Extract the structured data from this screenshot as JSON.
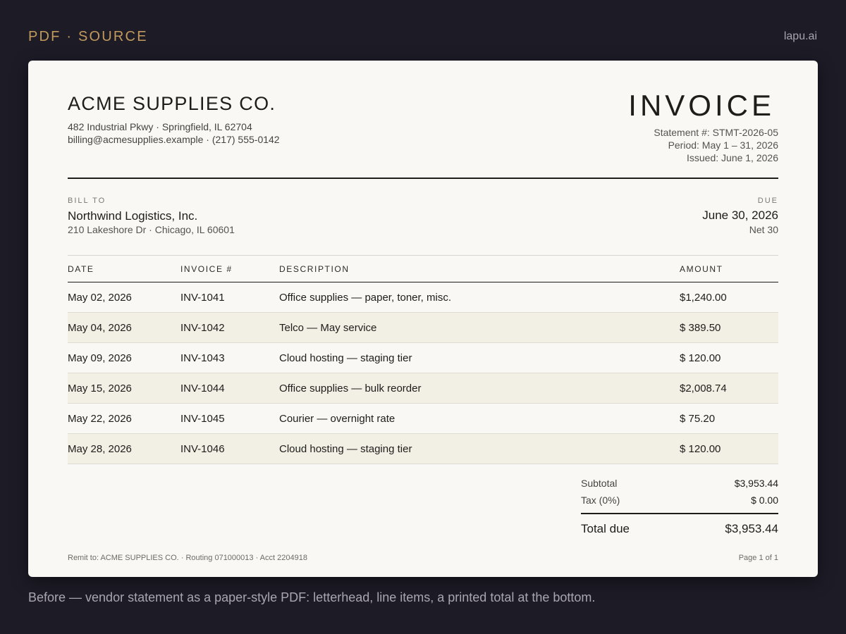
{
  "header": {
    "label": "PDF · SOURCE",
    "brand": "lapu.ai"
  },
  "invoice": {
    "company": "ACME SUPPLIES CO.",
    "address_line": "482 Industrial Pkwy · Springfield, IL 62704",
    "contact_line": "billing@acmesupplies.example  · (217) 555-0142",
    "title": "INVOICE",
    "statement": "Statement #: STMT-2026-05",
    "period": "Period: May 1 – 31, 2026",
    "issued": "Issued: June 1, 2026",
    "bill_to_label": "BILL TO",
    "bill_to_name": "Northwind Logistics, Inc.",
    "bill_to_address": "210 Lakeshore Dr · Chicago, IL 60601",
    "due_label": "DUE",
    "due_date": "June 30, 2026",
    "due_terms": "Net 30",
    "columns": {
      "date": "DATE",
      "invoice": "INVOICE #",
      "description": "DESCRIPTION",
      "amount": "AMOUNT"
    },
    "rows": [
      {
        "date": "May 02, 2026",
        "invoice": "INV-1041",
        "description": "Office supplies — paper, toner, misc.",
        "amount": "$1,240.00"
      },
      {
        "date": "May 04, 2026",
        "invoice": "INV-1042",
        "description": "Telco — May service",
        "amount": "$ 389.50"
      },
      {
        "date": "May 09, 2026",
        "invoice": "INV-1043",
        "description": "Cloud hosting — staging tier",
        "amount": "$ 120.00"
      },
      {
        "date": "May 15, 2026",
        "invoice": "INV-1044",
        "description": "Office supplies — bulk reorder",
        "amount": "$2,008.74"
      },
      {
        "date": "May 22, 2026",
        "invoice": "INV-1045",
        "description": "Courier — overnight rate",
        "amount": "$ 75.20"
      },
      {
        "date": "May 28, 2026",
        "invoice": "INV-1046",
        "description": "Cloud hosting — staging tier",
        "amount": "$ 120.00"
      }
    ],
    "subtotal_label": "Subtotal",
    "subtotal": "$3,953.44",
    "tax_label": "Tax (0%)",
    "tax": "$ 0.00",
    "total_label": "Total due",
    "total": "$3,953.44",
    "remit": "Remit to: ACME SUPPLIES CO. · Routing 071000013 · Acct 2204918",
    "page": "Page 1 of 1"
  },
  "caption": "Before — vendor statement  as a paper-style PDF: letterhead, line items, a printed total at the bottom."
}
